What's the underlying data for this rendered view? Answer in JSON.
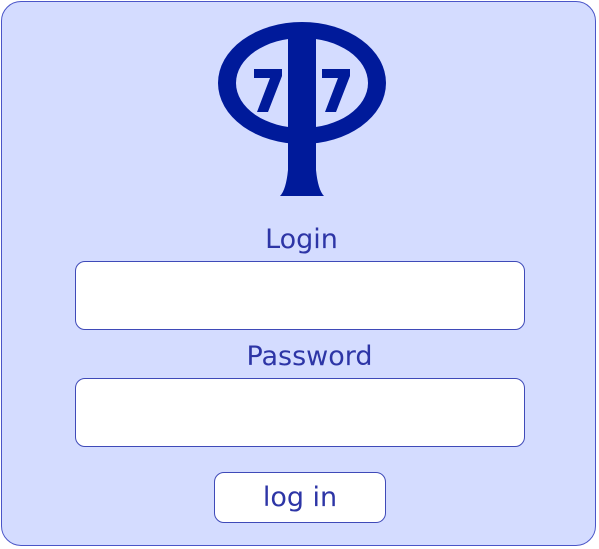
{
  "logo": {
    "icon": "cp77-logo",
    "digits": "77",
    "color": "#001a9a"
  },
  "form": {
    "login_label": "Login",
    "login_value": "",
    "password_label": "Password",
    "password_value": "",
    "submit_label": "log in"
  },
  "colors": {
    "card_background": "#d4dcff",
    "card_border": "#4a55c8",
    "label_text": "#2d35a6",
    "logo_fill": "#001a9a"
  }
}
